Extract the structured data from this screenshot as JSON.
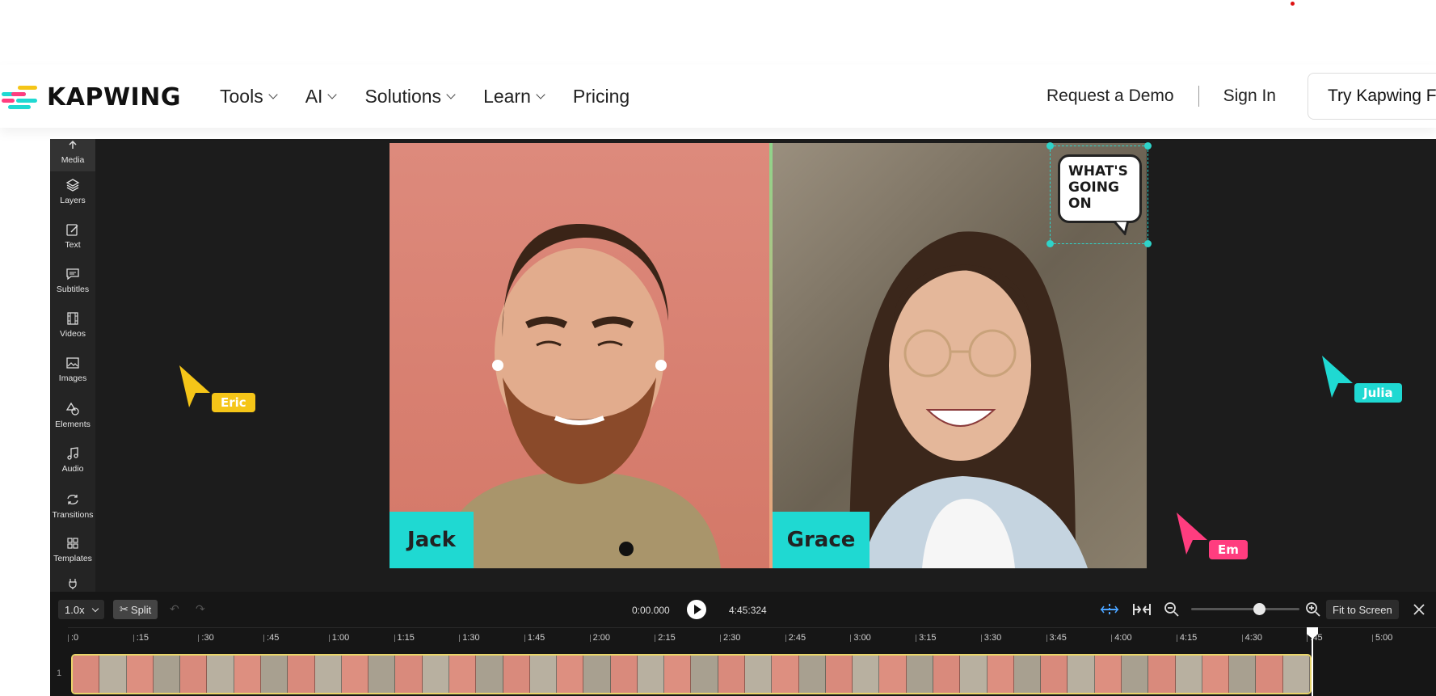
{
  "nav": {
    "brand": "KAPWING",
    "menu": [
      {
        "label": "Tools",
        "dropdown": true
      },
      {
        "label": "AI",
        "dropdown": true
      },
      {
        "label": "Solutions",
        "dropdown": true
      },
      {
        "label": "Learn",
        "dropdown": true
      },
      {
        "label": "Pricing",
        "dropdown": false
      }
    ],
    "request_demo": "Request a Demo",
    "sign_in": "Sign In",
    "try_button": "Try Kapwing F"
  },
  "sidebar": {
    "items": [
      {
        "label": "Media",
        "icon": "media-icon"
      },
      {
        "label": "Layers",
        "icon": "layers-icon"
      },
      {
        "label": "Text",
        "icon": "text-icon"
      },
      {
        "label": "Subtitles",
        "icon": "subtitles-icon"
      },
      {
        "label": "Videos",
        "icon": "videos-icon"
      },
      {
        "label": "Images",
        "icon": "images-icon"
      },
      {
        "label": "Elements",
        "icon": "elements-icon"
      },
      {
        "label": "Audio",
        "icon": "audio-icon"
      },
      {
        "label": "Transitions",
        "icon": "transitions-icon"
      },
      {
        "label": "Templates",
        "icon": "templates-icon"
      }
    ]
  },
  "canvas": {
    "left_name": "Jack",
    "right_name": "Grace",
    "sticker_lines": [
      "WHAT'S",
      "GOING",
      "ON"
    ]
  },
  "collaborators": [
    {
      "name": "Eric",
      "color": "#f5c518"
    },
    {
      "name": "Julia",
      "color": "#1fd9d2"
    },
    {
      "name": "Em",
      "color": "#ff3d7f"
    }
  ],
  "timeline": {
    "speed": "1.0x",
    "split_label": "Split",
    "current_time": "0:00.000",
    "total_time": "4:45:324",
    "fit_label": "Fit to Screen",
    "zoom_level": 0.65,
    "ruler": [
      ":0",
      ":15",
      ":30",
      ":45",
      "1:00",
      "1:15",
      "1:30",
      "1:45",
      "2:00",
      "2:15",
      "2:30",
      "2:45",
      "3:00",
      "3:15",
      "3:30",
      "3:45",
      "4:00",
      "4:15",
      "4:30",
      ":45",
      "5:00"
    ],
    "track_number": "1"
  },
  "colors": {
    "accent_cyan": "#1fd9d2",
    "brand_pink": "#ff3d7f",
    "brand_yellow": "#f5c518",
    "editor_bg": "#1c1c1c"
  }
}
